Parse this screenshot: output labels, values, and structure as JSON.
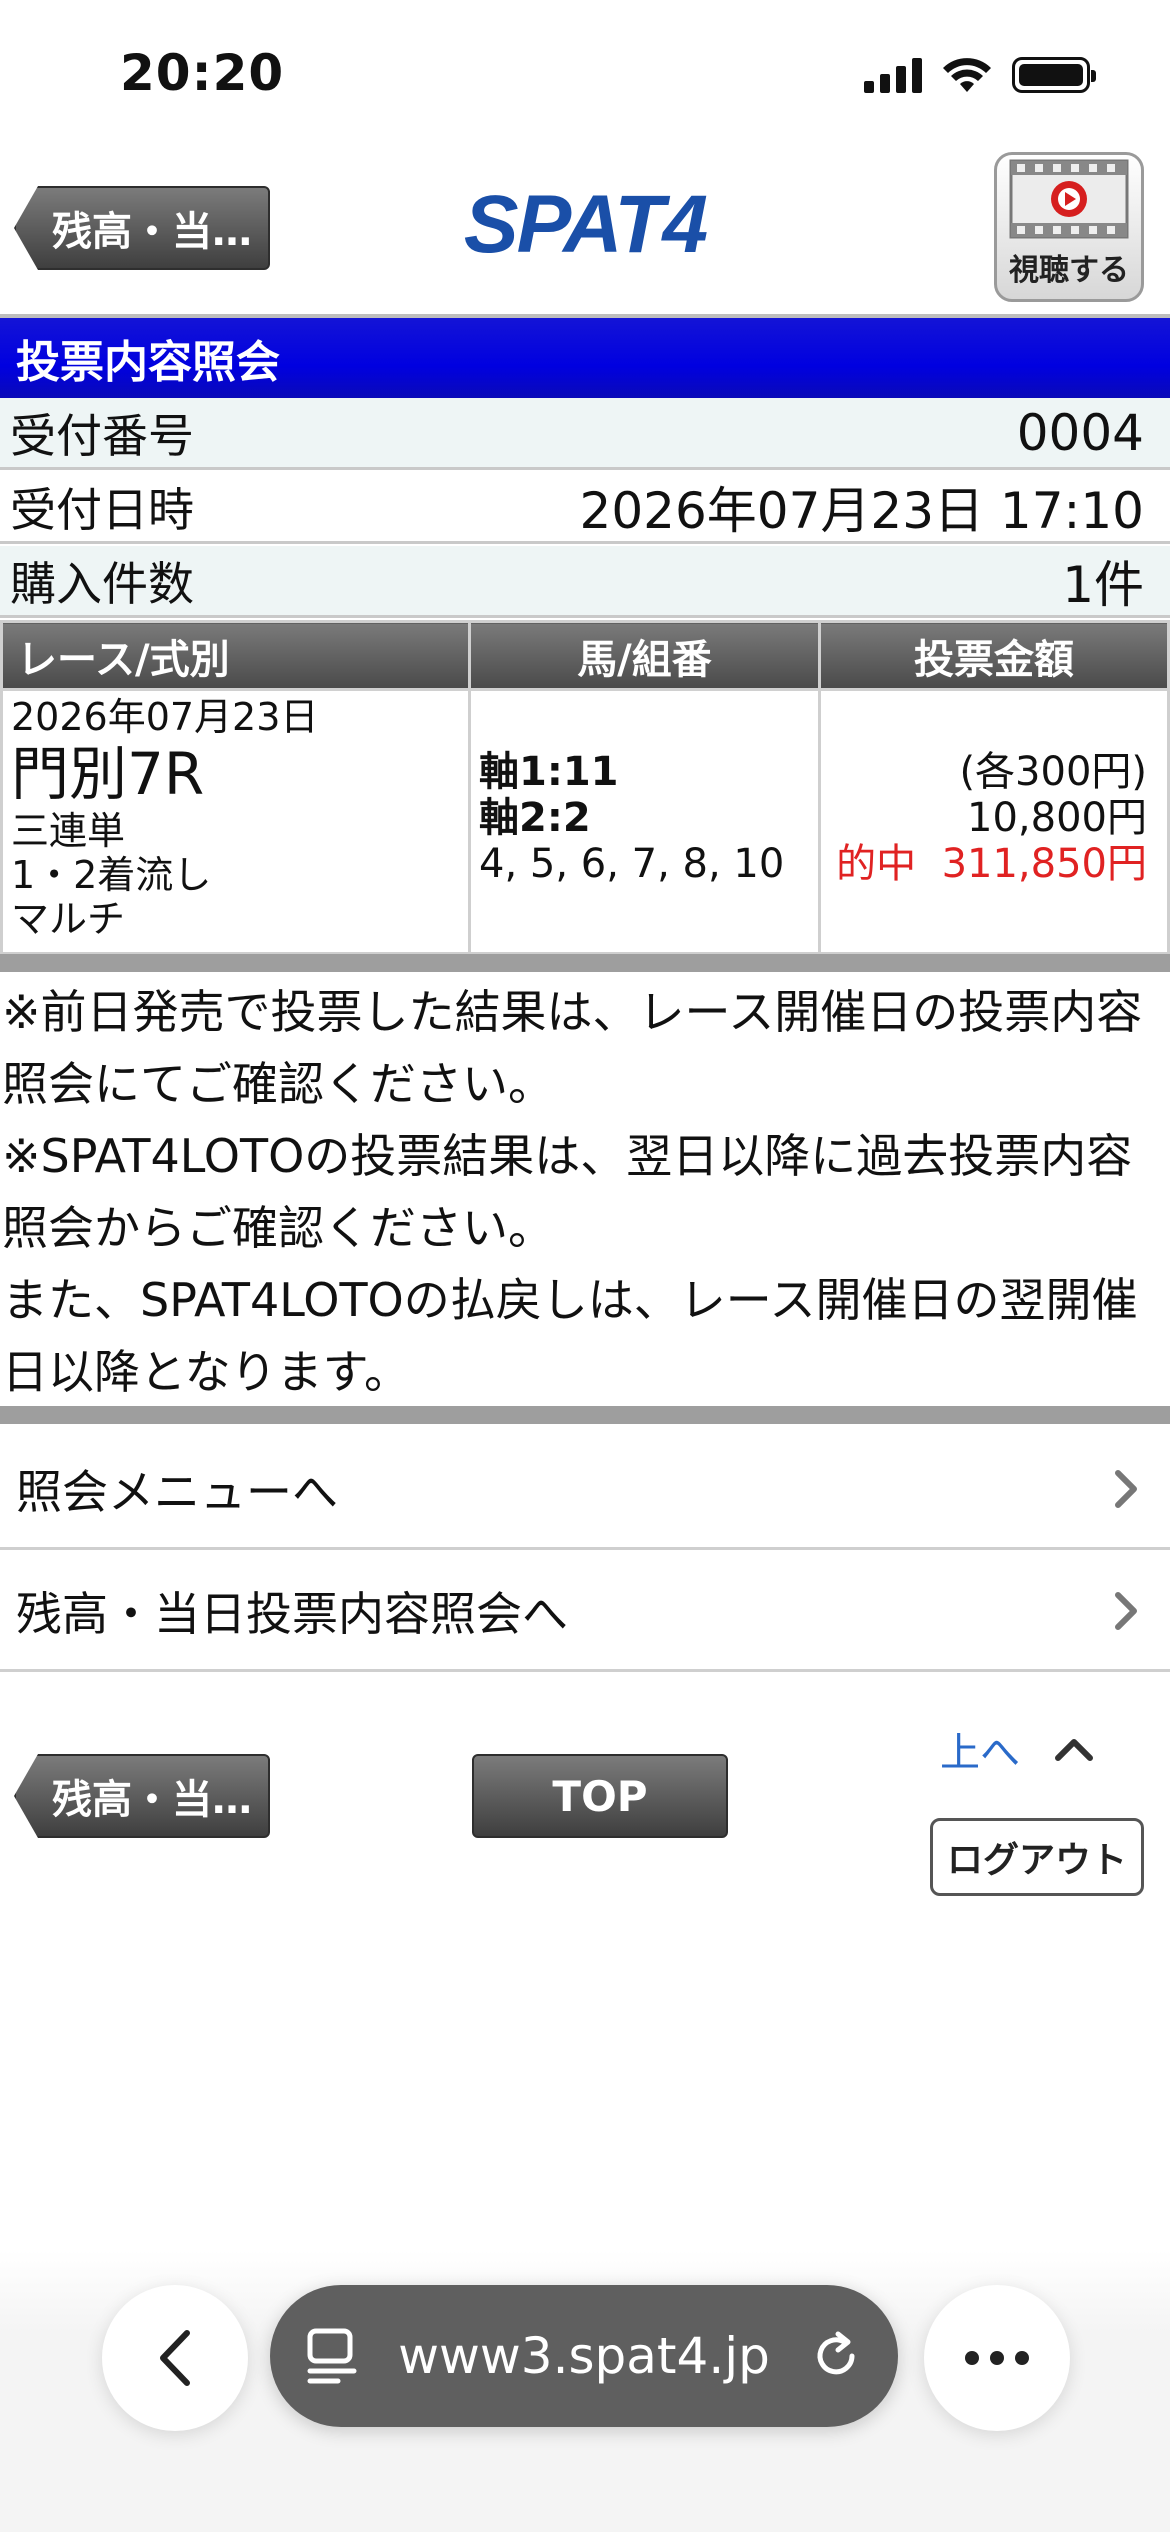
{
  "status_bar": {
    "time": "20:20",
    "icons": [
      "signal-icon",
      "wifi-icon",
      "battery-icon"
    ]
  },
  "header": {
    "back_label": "残高・当…",
    "logo_text": "SPAT4",
    "watch_label": "視聴する"
  },
  "page_title": "投票内容照会",
  "info_rows": [
    {
      "label": "受付番号",
      "value": "0004"
    },
    {
      "label": "受付日時",
      "value": "2026年07月23日 17:10"
    },
    {
      "label": "購入件数",
      "value": "1件"
    }
  ],
  "table": {
    "headers": [
      "レース/式別",
      "馬/組番",
      "投票金額"
    ],
    "row": {
      "date": "2026年07月23日",
      "race": "門別7R",
      "bet_type": "三連単",
      "method": "1・2着流し",
      "multi": "マルチ",
      "axis1": "軸1:11",
      "axis2": "軸2:2",
      "numbers": "4, 5, 6, 7, 8, 10",
      "each": "(各300円)",
      "amount": "10,800円",
      "hit": "的中  311,850円"
    }
  },
  "notes": [
    "※前日発売で投票した結果は、レース開催日の投票内容照会にてご確認ください。",
    "※SPAT4LOTOの投票結果は、翌日以降に過去投票内容照会からご確認ください。",
    "また、SPAT4LOTOの払戻しは、レース開催日の翌開催日以降となります。"
  ],
  "menu": [
    {
      "label": "照会メニューへ"
    },
    {
      "label": "残高・当日投票内容照会へ"
    }
  ],
  "footer": {
    "back_label": "残高・当…",
    "top_label": "TOP",
    "up_label": "上へ",
    "logout_label": "ログアウト"
  },
  "browser": {
    "url": "www3.spat4.jp"
  },
  "colors": {
    "title_bar": "#0000e0",
    "hit_red": "#e02222",
    "link_blue": "#2a6ac9",
    "logo_blue": "#1a4fa8"
  }
}
